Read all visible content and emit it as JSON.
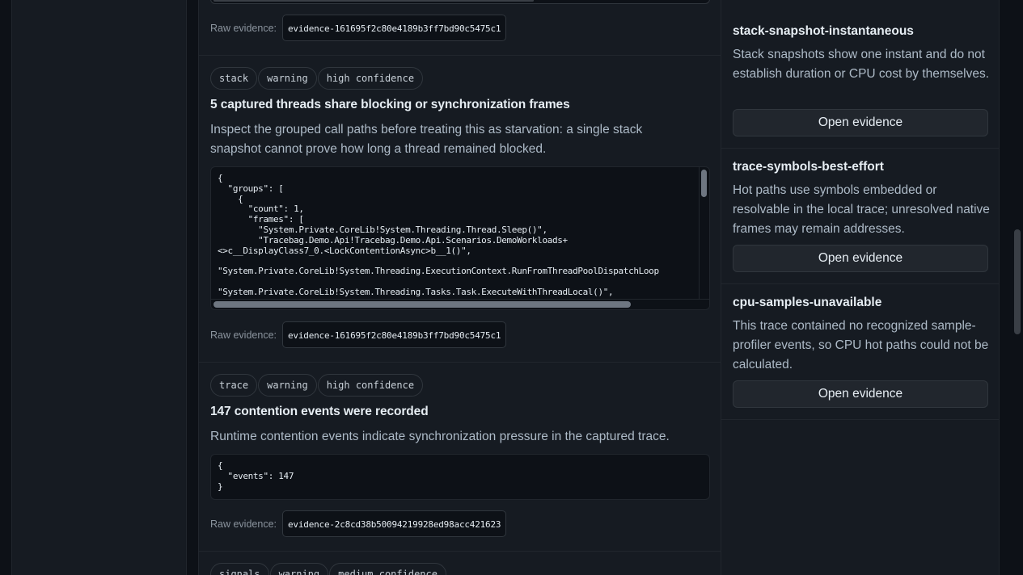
{
  "findings": [
    {
      "raw_label": "Raw evidence:",
      "raw_id": "evidence-161695f2c80e4189b3ff7bd90c5475c1"
    },
    {
      "badges": [
        "stack",
        "warning",
        "high confidence"
      ],
      "title": "5 captured threads share blocking or synchronization frames",
      "description": "Inspect the grouped call paths before treating this as starvation: a single stack snapshot cannot prove how long a thread remained blocked.",
      "code": "{\n  \"groups\": [\n    {\n      \"count\": 1,\n      \"frames\": [\n        \"System.Private.CoreLib!System.Threading.Thread.Sleep()\",\n        \"Tracebag.Demo.Api!Tracebag.Demo.Api.Scenarios.DemoWorkloads+\n<>c__DisplayClass7_0.<LockContentionAsync>b__1()\",\n\n\"System.Private.CoreLib!System.Threading.ExecutionContext.RunFromThreadPoolDispatchLoop\n\n\"System.Private.CoreLib!System.Threading.Tasks.Task.ExecuteWithThreadLocal()\",",
      "raw_label": "Raw evidence:",
      "raw_id": "evidence-161695f2c80e4189b3ff7bd90c5475c1"
    },
    {
      "badges": [
        "trace",
        "warning",
        "high confidence"
      ],
      "title": "147 contention events were recorded",
      "description": "Runtime contention events indicate synchronization pressure in the captured trace.",
      "code": "{\n  \"events\": 147\n}",
      "raw_label": "Raw evidence:",
      "raw_id": "evidence-2c8cd38b50094219928ed98acc421623"
    },
    {
      "badges": [
        "signals",
        "warning",
        "medium confidence"
      ]
    }
  ],
  "notes": [
    {
      "title": "stack-snapshot-instantaneous",
      "description": "Stack snapshots show one instant and do not establish duration or CPU cost by themselves.",
      "button": "Open evidence"
    },
    {
      "title": "trace-symbols-best-effort",
      "description": "Hot paths use symbols embedded or resolvable in the local trace; unresolved native frames may remain addresses.",
      "button": "Open evidence"
    },
    {
      "title": "cpu-samples-unavailable",
      "description": "This trace contained no recognized sample-profiler events, so CPU hot paths could not be calculated.",
      "button": "Open evidence"
    }
  ]
}
